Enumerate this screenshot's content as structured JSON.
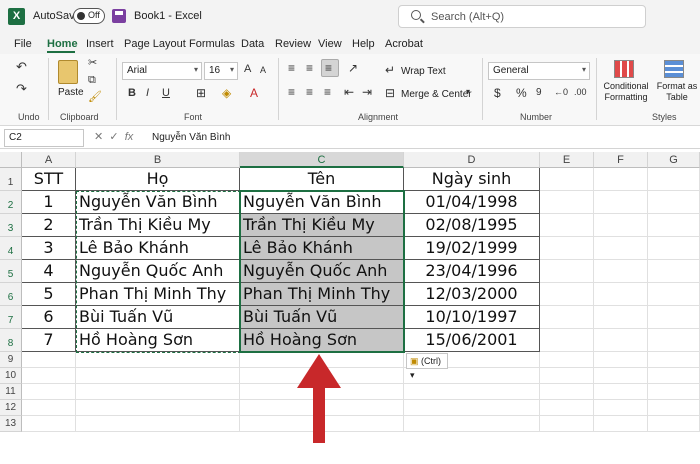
{
  "titlebar": {
    "autosave_label": "AutoSave",
    "autosave_state": "Off",
    "doc_title": "Book1  -  Excel",
    "search_placeholder": "Search (Alt+Q)"
  },
  "menu": {
    "tabs": [
      "File",
      "Home",
      "Insert",
      "Page Layout",
      "Formulas",
      "Data",
      "Review",
      "View",
      "Help",
      "Acrobat"
    ],
    "active": "Home"
  },
  "ribbon": {
    "undo_label": "Undo",
    "clipboard_label": "Clipboard",
    "paste_label": "Paste",
    "font_label": "Font",
    "font_name": "Arial",
    "font_size": "16",
    "alignment_label": "Alignment",
    "wrap_text": "Wrap Text",
    "merge_center": "Merge & Center",
    "number_label": "Number",
    "number_format": "General",
    "conditional_formatting": "Conditional Formatting",
    "format_as_table": "Format as Table",
    "styles_label": "Styles"
  },
  "formula_bar": {
    "name_box": "C2",
    "fx": "fx",
    "value": "Nguyễn Văn Bình"
  },
  "sheet": {
    "columns": [
      "A",
      "B",
      "C",
      "D",
      "E",
      "F",
      "G"
    ],
    "rows": [
      "1",
      "2",
      "3",
      "4",
      "5",
      "6",
      "7",
      "8",
      "9",
      "10",
      "11",
      "12",
      "13"
    ],
    "headers": [
      "STT",
      "Họ",
      "Tên",
      "Ngày sinh"
    ],
    "data": [
      [
        "1",
        "Nguyễn Văn Bình",
        "Nguyễn Văn Bình",
        "01/04/1998"
      ],
      [
        "2",
        "Trần Thị Kiều My",
        "Trần Thị Kiều My",
        "02/08/1995"
      ],
      [
        "3",
        "Lê Bảo Khánh",
        "Lê Bảo Khánh",
        "19/02/1999"
      ],
      [
        "4",
        "Nguyễn Quốc Anh",
        "Nguyễn Quốc Anh",
        "23/04/1996"
      ],
      [
        "5",
        "Phan Thị Minh Thy",
        "Phan Thị Minh Thy",
        "12/03/2000"
      ],
      [
        "6",
        "Bùi Tuấn Vũ",
        "Bùi Tuấn Vũ",
        "10/10/1997"
      ],
      [
        "7",
        "Hồ Hoàng Sơn",
        "Hồ Hoàng Sơn",
        "15/06/2001"
      ]
    ]
  },
  "paste_options_label": "(Ctrl)",
  "colors": {
    "accent": "#1d6f42",
    "arrow": "#c8282a",
    "selection_fill": "#c6c6c6"
  }
}
